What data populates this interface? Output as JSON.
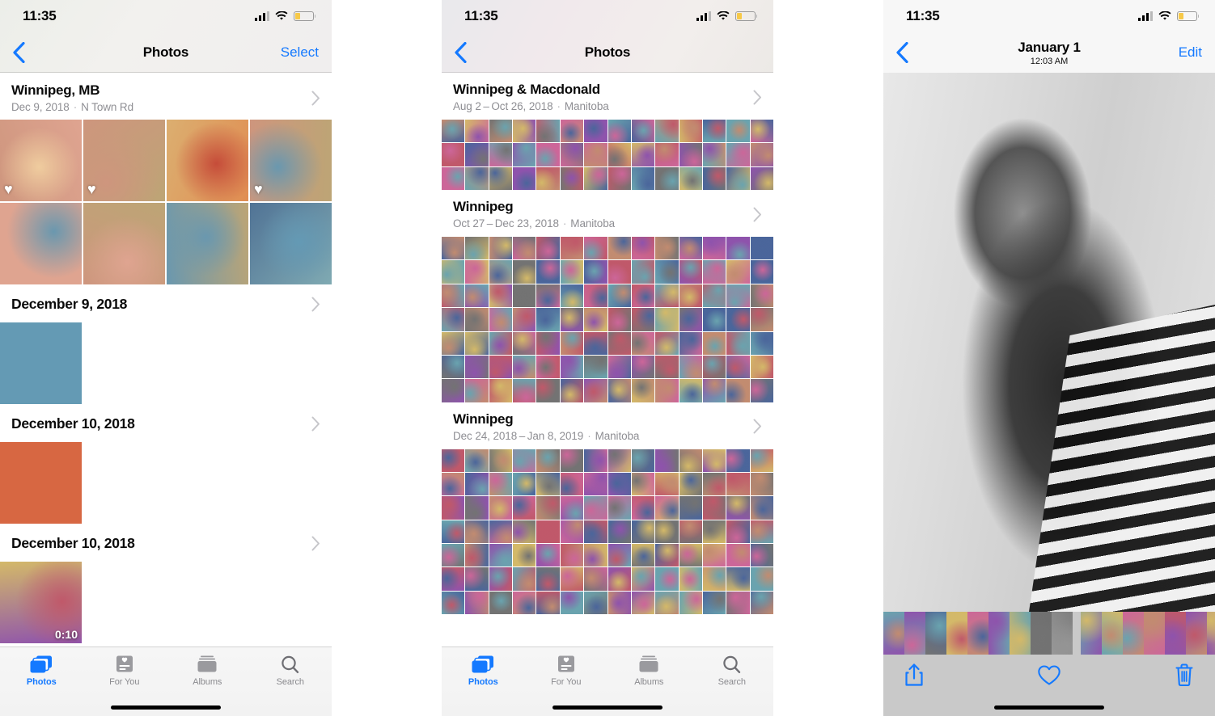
{
  "accent": "#1479ff",
  "status_bar": {
    "time": "11:35",
    "signal_icon": "cellular-bars-icon",
    "wifi_icon": "wifi-icon",
    "battery_icon": "battery-low-icon"
  },
  "tabs": [
    {
      "label": "Photos",
      "icon": "photos-icon",
      "active": true
    },
    {
      "label": "For You",
      "icon": "for-you-icon",
      "active": false
    },
    {
      "label": "Albums",
      "icon": "albums-icon",
      "active": false
    },
    {
      "label": "Search",
      "icon": "search-icon",
      "active": false
    }
  ],
  "phone1": {
    "nav": {
      "back_icon": "chevron-left-icon",
      "title": "Photos",
      "action": "Select"
    },
    "moment": {
      "title": "Winnipeg, MB",
      "date": "Dec 9, 2018",
      "separator": "·",
      "place": "N Town Rd",
      "chevron": "chevron-right-icon"
    },
    "days": [
      {
        "title": "December 9, 2018",
        "chevron": "chevron-right-icon",
        "duration": ""
      },
      {
        "title": "December 10, 2018",
        "chevron": "chevron-right-icon",
        "duration": ""
      },
      {
        "title": "December 10, 2018",
        "chevron": "chevron-right-icon",
        "duration": "0:10"
      }
    ]
  },
  "phone2": {
    "nav": {
      "back_icon": "chevron-left-icon",
      "title": "Photos",
      "action": ""
    },
    "sections": [
      {
        "title": "Winnipeg & Macdonald",
        "date": "Aug 2 – Oct 26, 2018",
        "separator": "·",
        "place": "Manitoba",
        "chevron": "chevron-right-icon"
      },
      {
        "title": "Winnipeg",
        "date": "Oct 27 – Dec 23, 2018",
        "separator": "·",
        "place": "Manitoba",
        "chevron": "chevron-right-icon"
      },
      {
        "title": "Winnipeg",
        "date": "Dec 24, 2018 – Jan 8, 2019",
        "separator": "·",
        "place": "Manitoba",
        "chevron": "chevron-right-icon"
      }
    ]
  },
  "phone3": {
    "nav": {
      "back_icon": "chevron-left-icon",
      "title": "January 1",
      "subtitle": "12:03 AM",
      "action": "Edit"
    },
    "toolbar": [
      {
        "name": "share-icon",
        "label": "Share"
      },
      {
        "name": "favorite-icon",
        "label": "Favorite"
      },
      {
        "name": "delete-icon",
        "label": "Delete"
      }
    ]
  }
}
